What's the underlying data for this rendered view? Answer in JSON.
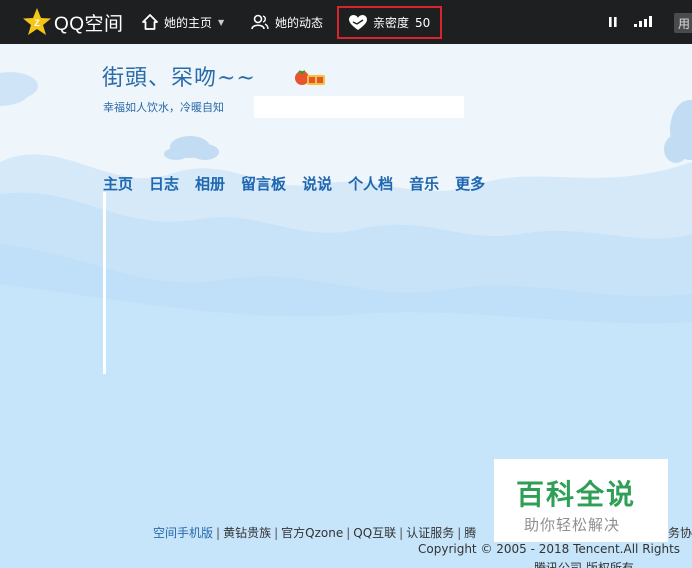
{
  "topbar": {
    "logo_text": "QQ空间",
    "nav_home": "她的主页",
    "nav_feed": "她的动态",
    "intimacy_label": "亲密度",
    "intimacy_value": "50",
    "user_button": "用"
  },
  "space": {
    "title": "街頭、罙吻~~",
    "subtitle": "幸福如人饮水，冷暖自知"
  },
  "tabs": [
    "主页",
    "日志",
    "相册",
    "留言板",
    "说说",
    "个人档",
    "音乐",
    "更多"
  ],
  "footer": {
    "links": [
      {
        "label": "空间手机版",
        "accent": true
      },
      {
        "label": "黄钻贵族",
        "accent": false
      },
      {
        "label": "官方Qzone",
        "accent": false
      },
      {
        "label": "QQ互联",
        "accent": false
      },
      {
        "label": "认证服务",
        "accent": false
      },
      {
        "label": "腾",
        "accent": false
      }
    ],
    "trailing_text": "务协",
    "copyright": "Copyright © 2005 - 2018 Tencent.All Rights",
    "rights": "腾讯公司 版权所有"
  },
  "watermark": {
    "title": "百科全说",
    "subtitle": "助你轻松解决"
  },
  "colors": {
    "topbar_bg": "#1e1f21",
    "accent_blue": "#1f67b0",
    "highlight_red": "#d8242a",
    "watermark_green": "#2f9e57"
  }
}
